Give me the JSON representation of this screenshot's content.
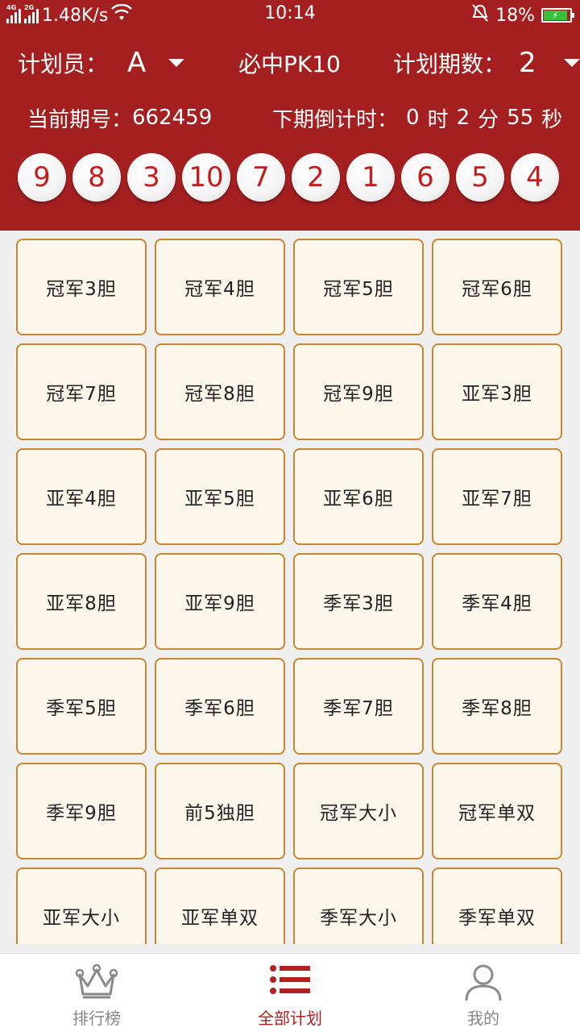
{
  "status_bar": {
    "network_speed": "1.48K/s",
    "time": "10:14",
    "battery_percent": "18%",
    "sim1_label": "4G",
    "sim2_label": "2G"
  },
  "header": {
    "planner_label": "计划员：",
    "planner_value": "A",
    "title": "必中PK10",
    "periods_label": "计划期数：",
    "periods_value": "2",
    "current_issue_label": "当前期号：",
    "current_issue_value": "662459",
    "countdown_label": "下期倒计时：",
    "countdown_hours": "0",
    "countdown_hours_unit": "时",
    "countdown_minutes": "2",
    "countdown_minutes_unit": "分",
    "countdown_seconds": "55",
    "countdown_seconds_unit": "秒"
  },
  "balls": [
    "9",
    "8",
    "3",
    "10",
    "7",
    "2",
    "1",
    "6",
    "5",
    "4"
  ],
  "plans": [
    "冠军3胆",
    "冠军4胆",
    "冠军5胆",
    "冠军6胆",
    "冠军7胆",
    "冠军8胆",
    "冠军9胆",
    "亚军3胆",
    "亚军4胆",
    "亚军5胆",
    "亚军6胆",
    "亚军7胆",
    "亚军8胆",
    "亚军9胆",
    "季军3胆",
    "季军4胆",
    "季军5胆",
    "季军6胆",
    "季军7胆",
    "季军8胆",
    "季军9胆",
    "前5独胆",
    "冠军大小",
    "冠军单双",
    "亚军大小",
    "亚军单双",
    "季军大小",
    "季军单双"
  ],
  "tabs": [
    {
      "label": "排行榜",
      "icon": "crown-icon",
      "active": false
    },
    {
      "label": "全部计划",
      "icon": "list-icon",
      "active": true
    },
    {
      "label": "我的",
      "icon": "user-icon",
      "active": false
    }
  ],
  "colors": {
    "header_bg": "#a42020",
    "tile_bg": "#fdf6ea",
    "tile_border": "#c8862e",
    "active_tab": "#b41f1f",
    "ball_text": "#c41d1d"
  }
}
